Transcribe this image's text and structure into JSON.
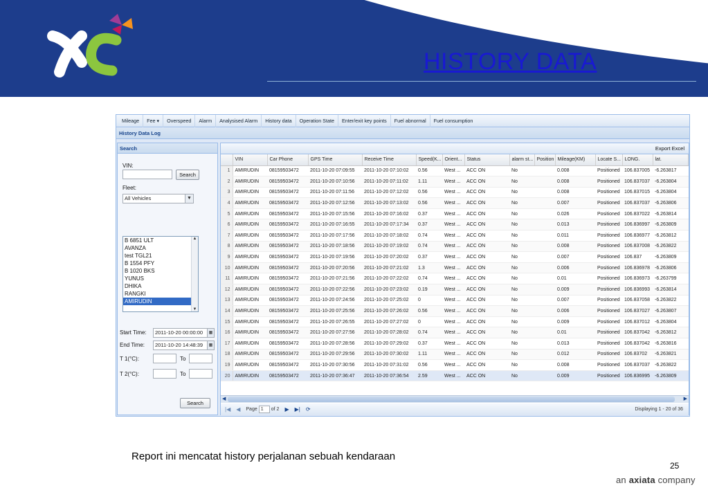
{
  "slide": {
    "title": "HISTORY DATA",
    "caption": "Report ini mencatat history perjalanan sebuah kendaraan",
    "page_number": "25",
    "company_tag_prefix": "an",
    "company_tag_brand": "axiata",
    "company_tag_suffix": "company"
  },
  "colors": {
    "header_band": "#1d3d8c",
    "title": "#1919d2",
    "logo_green": "#8cc63f",
    "logo_purple": "#a03c96",
    "logo_orange": "#f7931e",
    "selection": "#316ac5"
  },
  "menu": [
    "Mileage",
    "Fee ▾",
    "Overspeed",
    "Alarm",
    "Analysised Alarm",
    "History data",
    "Operation State",
    "Enter/exit key points",
    "Fuel abnormal",
    "Fuel consumption"
  ],
  "panel_title": "History Data Log",
  "search": {
    "header": "Search",
    "vin_label": "VIN:",
    "vin_value": "",
    "search_button": "Search",
    "fleet_label": "Fleet:",
    "fleet_value": "All Vehicles",
    "vehicles": [
      "B 6851 ULT",
      "AVANZA",
      "test TGL21",
      "B 1554 PFY",
      "B 1020 BKS",
      "YUNUS",
      "DHIKA",
      "RANGKI",
      "AMIRUDIN"
    ],
    "selected_vehicle": "AMIRUDIN",
    "start_label": "Start Time:",
    "start_value": "2011-10-20 00:00:00",
    "end_label": "End Time:",
    "end_value": "2011-10-20 14:48:39",
    "t1_label": "T 1(°C):",
    "t2_label": "T 2(°C):",
    "to_label": "To",
    "bottom_search_button": "Search"
  },
  "grid": {
    "export_label": "Export Excel",
    "columns": [
      "",
      "VIN",
      "Car Phone",
      "GPS Time",
      "Receive Time",
      "Speed(K...",
      "Orient...",
      "Status",
      "alarm st...",
      "Position",
      "Mileage(KM)",
      "Locate S...",
      "LONG.",
      "lat."
    ],
    "rows": [
      [
        "1",
        "AMIRUDIN",
        "08159503472",
        "2011-10-20 07:09:55",
        "2011-10-20 07:10:02",
        "0.56",
        "West ...",
        "ACC ON",
        "No",
        "",
        "0.008",
        "Positioned",
        "106.837005",
        "-6.263817"
      ],
      [
        "2",
        "AMIRUDIN",
        "08159503472",
        "2011-10-20 07:10:56",
        "2011-10-20 07:11:02",
        "1.11",
        "West ...",
        "ACC ON",
        "No",
        "",
        "0.008",
        "Positioned",
        "106.837037",
        "-6.263804"
      ],
      [
        "3",
        "AMIRUDIN",
        "08159503472",
        "2011-10-20 07:11:56",
        "2011-10-20 07:12:02",
        "0.56",
        "West ...",
        "ACC ON",
        "No",
        "",
        "0.008",
        "Positioned",
        "106.837015",
        "-6.263804"
      ],
      [
        "4",
        "AMIRUDIN",
        "08159503472",
        "2011-10-20 07:12:56",
        "2011-10-20 07:13:02",
        "0.56",
        "West ...",
        "ACC ON",
        "No",
        "",
        "0.007",
        "Positioned",
        "106.837037",
        "-6.263806"
      ],
      [
        "5",
        "AMIRUDIN",
        "08159503472",
        "2011-10-20 07:15:56",
        "2011-10-20 07:16:02",
        "0.37",
        "West ...",
        "ACC ON",
        "No",
        "",
        "0.026",
        "Positioned",
        "106.837022",
        "-6.263814"
      ],
      [
        "6",
        "AMIRUDIN",
        "08159503472",
        "2011-10-20 07:16:55",
        "2011-10-20 07:17:34",
        "0.37",
        "West ...",
        "ACC ON",
        "No",
        "",
        "0.013",
        "Positioned",
        "106.836997",
        "-6.263809"
      ],
      [
        "7",
        "AMIRUDIN",
        "08159503472",
        "2011-10-20 07:17:56",
        "2011-10-20 07:18:02",
        "0.74",
        "West ...",
        "ACC ON",
        "No",
        "",
        "0.011",
        "Positioned",
        "106.836977",
        "-6.263812"
      ],
      [
        "8",
        "AMIRUDIN",
        "08159503472",
        "2011-10-20 07:18:56",
        "2011-10-20 07:19:02",
        "0.74",
        "West ...",
        "ACC ON",
        "No",
        "",
        "0.008",
        "Positioned",
        "106.837008",
        "-6.263822"
      ],
      [
        "9",
        "AMIRUDIN",
        "08159503472",
        "2011-10-20 07:19:56",
        "2011-10-20 07:20:02",
        "0.37",
        "West ...",
        "ACC ON",
        "No",
        "",
        "0.007",
        "Positioned",
        "106.837",
        "-6.263809"
      ],
      [
        "10",
        "AMIRUDIN",
        "08159503472",
        "2011-10-20 07:20:56",
        "2011-10-20 07:21:02",
        "1.3",
        "West ...",
        "ACC ON",
        "No",
        "",
        "0.006",
        "Positioned",
        "106.836978",
        "-6.263806"
      ],
      [
        "11",
        "AMIRUDIN",
        "08159503472",
        "2011-10-20 07:21:56",
        "2011-10-20 07:22:02",
        "0.74",
        "West ...",
        "ACC ON",
        "No",
        "",
        "0.01",
        "Positioned",
        "106.836973",
        "-6.263799"
      ],
      [
        "12",
        "AMIRUDIN",
        "08159503472",
        "2011-10-20 07:22:56",
        "2011-10-20 07:23:02",
        "0.19",
        "West ...",
        "ACC ON",
        "No",
        "",
        "0.009",
        "Positioned",
        "106.836993",
        "-6.263814"
      ],
      [
        "13",
        "AMIRUDIN",
        "08159503472",
        "2011-10-20 07:24:56",
        "2011-10-20 07:25:02",
        "0",
        "West ...",
        "ACC ON",
        "No",
        "",
        "0.007",
        "Positioned",
        "106.837058",
        "-6.263822"
      ],
      [
        "14",
        "AMIRUDIN",
        "08159503472",
        "2011-10-20 07:25:56",
        "2011-10-20 07:26:02",
        "0.56",
        "West ...",
        "ACC ON",
        "No",
        "",
        "0.006",
        "Positioned",
        "106.837027",
        "-6.263807"
      ],
      [
        "15",
        "AMIRUDIN",
        "08159503472",
        "2011-10-20 07:26:55",
        "2011-10-20 07:27:02",
        "0",
        "West ...",
        "ACC ON",
        "No",
        "",
        "0.009",
        "Positioned",
        "106.837012",
        "-6.263804"
      ],
      [
        "16",
        "AMIRUDIN",
        "08159503472",
        "2011-10-20 07:27:56",
        "2011-10-20 07:28:02",
        "0.74",
        "West ...",
        "ACC ON",
        "No",
        "",
        "0.01",
        "Positioned",
        "106.837042",
        "-6.263812"
      ],
      [
        "17",
        "AMIRUDIN",
        "08159503472",
        "2011-10-20 07:28:56",
        "2011-10-20 07:29:02",
        "0.37",
        "West ...",
        "ACC ON",
        "No",
        "",
        "0.013",
        "Positioned",
        "106.837042",
        "-6.263816"
      ],
      [
        "18",
        "AMIRUDIN",
        "08159503472",
        "2011-10-20 07:29:56",
        "2011-10-20 07:30:02",
        "1.11",
        "West ...",
        "ACC ON",
        "No",
        "",
        "0.012",
        "Positioned",
        "106.83702",
        "-6.263821"
      ],
      [
        "19",
        "AMIRUDIN",
        "08159503472",
        "2011-10-20 07:30:56",
        "2011-10-20 07:31:02",
        "0.56",
        "West ...",
        "ACC ON",
        "No",
        "",
        "0.008",
        "Positioned",
        "106.837037",
        "-6.263822"
      ],
      [
        "20",
        "AMIRUDIN",
        "08159503472",
        "2011-10-20 07:36:47",
        "2011-10-20 07:36:54",
        "2.59",
        "West ...",
        "ACC ON",
        "No",
        "",
        "0.009",
        "Positioned",
        "106.836995",
        "-6.263809"
      ]
    ]
  },
  "pager": {
    "page_label": "Page",
    "page_value": "1",
    "of_label": "of 2",
    "displaying": "Displaying 1 - 20 of 36"
  }
}
